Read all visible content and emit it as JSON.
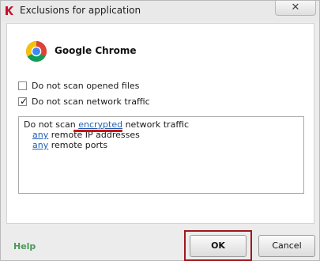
{
  "window": {
    "title": "Exclusions for application",
    "close_glyph": "✕"
  },
  "application": {
    "name": "Google Chrome",
    "icon": "chrome-icon"
  },
  "options": [
    {
      "label": "Do not scan opened files",
      "checked": false
    },
    {
      "label": "Do not scan network traffic",
      "checked": true
    }
  ],
  "rules": {
    "line1_prefix": "Do not scan ",
    "line1_link": "encrypted",
    "line1_suffix": " network traffic",
    "line2_link": "any",
    "line2_suffix": " remote IP addresses",
    "line3_link": "any",
    "line3_suffix": " remote ports"
  },
  "footer": {
    "help_label": "Help",
    "ok_label": "OK",
    "cancel_label": "Cancel"
  },
  "colors": {
    "link": "#1d5fb3",
    "help": "#4a9a5a",
    "highlight": "#a0181c"
  }
}
